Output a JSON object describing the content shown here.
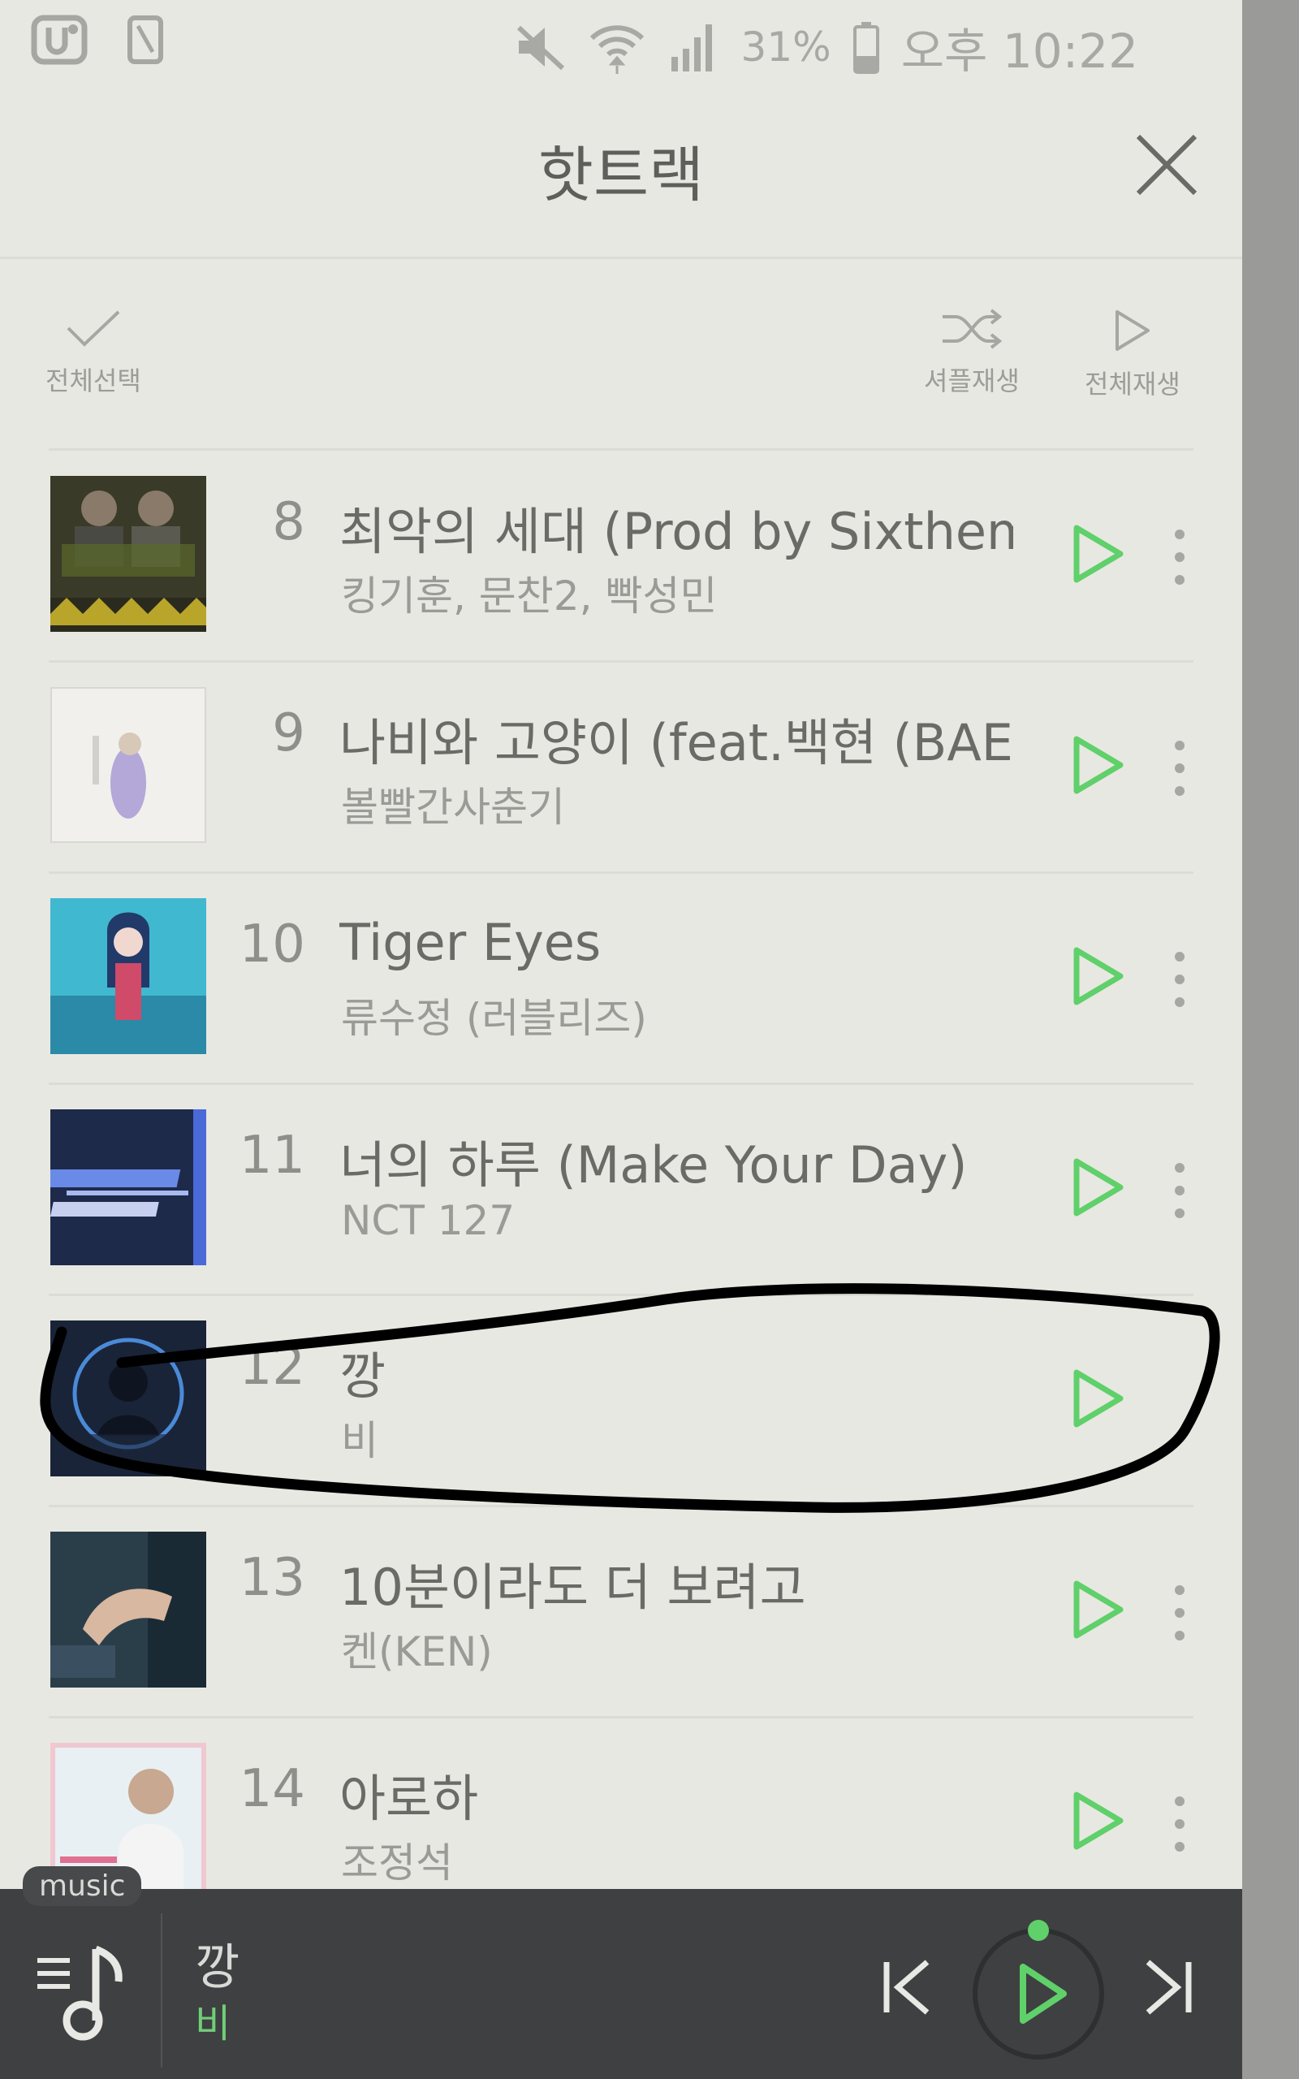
{
  "status_bar": {
    "battery": "31%",
    "time": "오후 10:22",
    "left_icons": [
      "u-plus-icon",
      "phone-icon"
    ],
    "right_icons": [
      "mute-icon",
      "wifi-icon",
      "signal-icon",
      "battery-icon"
    ]
  },
  "header": {
    "title": "핫트랙",
    "close_icon": "close-icon"
  },
  "toolbar": {
    "select_all": "전체선택",
    "shuffle_play": "셔플재생",
    "play_all": "전체재생"
  },
  "tracks": [
    {
      "rank": "8",
      "title": "최악의 세대 (Prod by Sixthem...",
      "artist": "킹기훈, 문찬2, 빡성민"
    },
    {
      "rank": "9",
      "title": "나비와 고양이 (feat.백현 (BAE...",
      "artist": "볼빨간사춘기"
    },
    {
      "rank": "10",
      "title": "Tiger Eyes",
      "artist": "류수정 (러블리즈)"
    },
    {
      "rank": "11",
      "title": "너의 하루 (Make Your Day)",
      "artist": "NCT 127"
    },
    {
      "rank": "12",
      "title": "깡",
      "artist": "비"
    },
    {
      "rank": "13",
      "title": "10분이라도 더 보려고",
      "artist": "켄(KEN)"
    },
    {
      "rank": "14",
      "title": "아로하",
      "artist": "조정석"
    }
  ],
  "mini_player": {
    "badge": "music",
    "now_playing_title": "깡",
    "now_playing_artist": "비"
  },
  "colors": {
    "accent_green": "#5fd06a",
    "background": "#e8e8e2",
    "player_bg": "#3f4041"
  }
}
